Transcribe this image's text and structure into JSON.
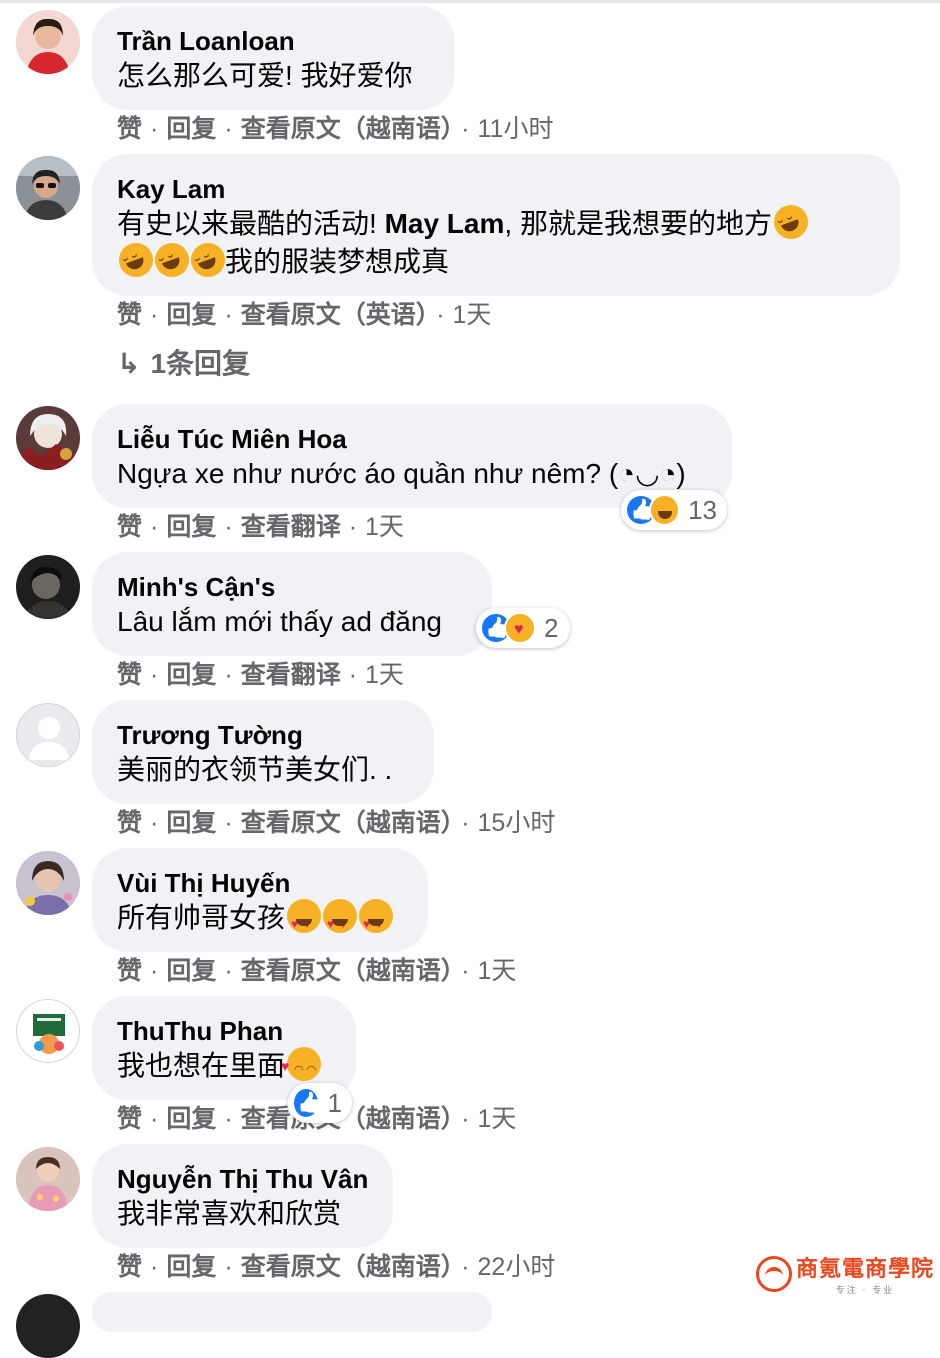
{
  "colors": {
    "bubble": "#f0f2f5",
    "meta_text": "#65676b",
    "like_blue": "#1877f2",
    "emoji_yellow": "#f7b125"
  },
  "action_labels": {
    "like": "赞",
    "reply": "回复",
    "dot": "·"
  },
  "comments": [
    {
      "name": "Trần Loanloan",
      "text": "怎么那么可爱! 我好爱你",
      "translate_label": "查看原文（越南语）",
      "time": "11小时",
      "avatar_icon": "woman-red-shirt"
    },
    {
      "name": "Kay Lam",
      "text_line1": "有史以来最酷的活动! ",
      "mention": "May Lam",
      "text_line1_end": ", 那就是我想要的地方",
      "text_line2": "我的服装梦想成真",
      "emojis": "rofl",
      "translate_label": "查看原文（英语）",
      "time": "1天",
      "reply_count_label": "1条回复",
      "avatar_icon": "woman-sunglasses"
    },
    {
      "name": "Liễu Túc Miên Hoa",
      "text": "Ngựa xe như nước áo quần như nêm? (◔◡◔)",
      "translate_label": "查看翻译",
      "time": "1天",
      "reaction_count": "13",
      "reaction_icons": [
        "like-icon",
        "haha-icon"
      ],
      "avatar_icon": "anime-art"
    },
    {
      "name": "Minh's Cận's",
      "text": "Lâu lắm mới thấy ad đăng",
      "translate_label": "查看翻译",
      "time": "1天",
      "reaction_count": "2",
      "reaction_icons": [
        "like-icon",
        "care-icon"
      ],
      "avatar_icon": "dark-portrait"
    },
    {
      "name": "Trương Tường",
      "text": "美丽的衣领节美女们. .",
      "translate_label": "查看原文（越南语）",
      "time": "15小时",
      "avatar_icon": "default-silhouette"
    },
    {
      "name": "Vùi Thị Huyến",
      "text": "所有帅哥女孩",
      "emojis": "heart-eyes",
      "translate_label": "查看原文（越南语）",
      "time": "1天",
      "avatar_icon": "girl-photo"
    },
    {
      "name": "ThuThu Phan",
      "text": "我也想在里面",
      "emojis": "smiling-face-hearts",
      "translate_label": "查看原文（越南语）",
      "time": "1天",
      "reaction_count": "1",
      "reaction_icons": [
        "like-icon"
      ],
      "avatar_icon": "green-logo"
    },
    {
      "name": "Nguyễn Thị Thu Vân",
      "text": "我非常喜欢和欣赏",
      "translate_label": "查看原文（越南语）",
      "time": "22小时",
      "avatar_icon": "child-pink-dress"
    }
  ],
  "watermark": {
    "text": "商氪電商學院",
    "sub": "专注 · 专业"
  }
}
